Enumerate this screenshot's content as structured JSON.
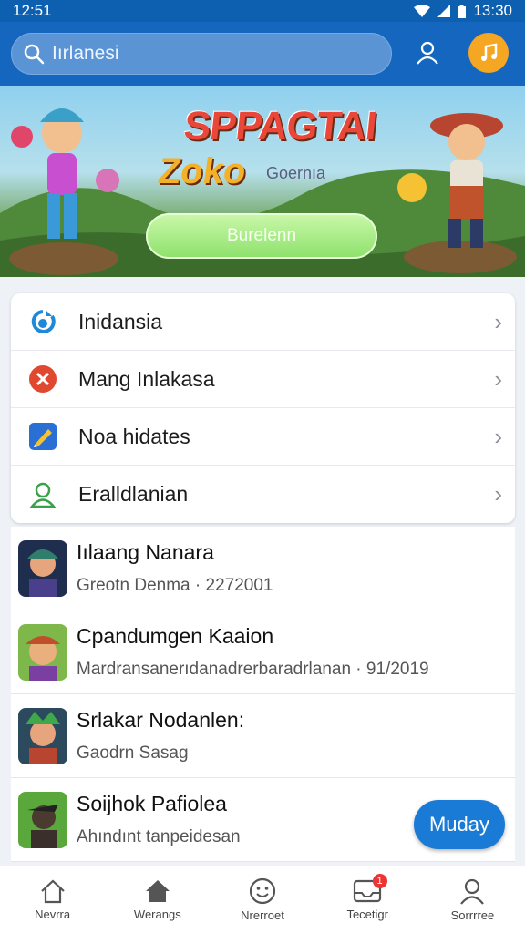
{
  "status": {
    "time_left": "12:51",
    "time_right": "13:30"
  },
  "search": {
    "value": "Iırlanesi"
  },
  "banner": {
    "title_line1": "SPPAGTAI",
    "title_line2": "Zoko",
    "subtitle": "Goernıa",
    "button_label": "Burelenn"
  },
  "menu": [
    {
      "label": "Inidansia",
      "icon": "swirl-icon",
      "color": "#1f88d8"
    },
    {
      "label": "Mang Inlakasa",
      "icon": "cross-circle-icon",
      "color": "#e0492f"
    },
    {
      "label": "Noa hidates",
      "icon": "pencil-icon",
      "color": "#2a6fd4"
    },
    {
      "label": "Eralldlanian",
      "icon": "person-outline-icon",
      "color": "#3aa14a"
    }
  ],
  "list": [
    {
      "title": "Iılaang Nanara",
      "subtitle": "Greotn Denma · 2272001"
    },
    {
      "title": "Cpandumgen Kaaion",
      "subtitle": "Mardransanerıdanadrerbaradrlanan · 91/2019"
    },
    {
      "title": "Srlakar Nodanlen:",
      "subtitle": "Gaodrn Sasag"
    },
    {
      "title": "Soijhok Pafiolea",
      "subtitle": "Ahındınt tanpeidesan"
    }
  ],
  "fab_label": "Muday",
  "nav": [
    {
      "label": "Nevrra",
      "icon": "home-outline-icon"
    },
    {
      "label": "Werangs",
      "icon": "home-filled-icon"
    },
    {
      "label": "Nrerroet",
      "icon": "smiley-icon"
    },
    {
      "label": "Tecetigr",
      "icon": "inbox-icon",
      "badge": "1"
    },
    {
      "label": "Sorrrree",
      "icon": "profile-icon"
    }
  ]
}
